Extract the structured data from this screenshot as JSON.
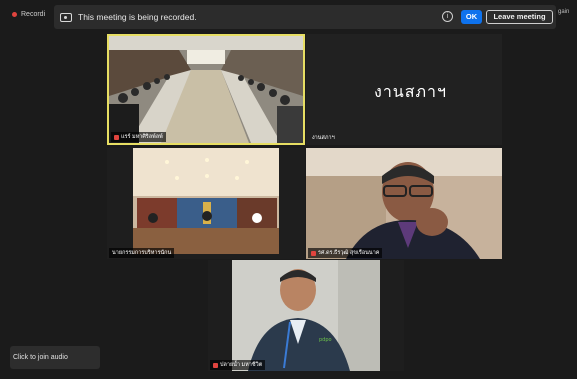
{
  "top": {
    "recording_status": "Recordi",
    "banner_message": "This meeting is being recorded.",
    "ok_label": "OK",
    "leave_label": "Leave meeting",
    "right_label": "gain"
  },
  "tiles": [
    {
      "id": "t1",
      "name": "แรร์ มหาศิริลพ์ลพ์",
      "muted": true
    },
    {
      "id": "t2",
      "display_text": "งานสภาฯ",
      "name": "งานสภาฯ",
      "muted": false
    },
    {
      "id": "t3",
      "name": "นายกรรมการบริหารนักน",
      "muted": false
    },
    {
      "id": "t4",
      "name": "รศ.ดร.ธีรวุฒิ สุขเรือนนาค",
      "muted": true
    },
    {
      "id": "t5",
      "name": "ปลายน้ำ มหาชีวิต",
      "muted": true
    }
  ],
  "audio": {
    "join_label": "Click to join audio"
  },
  "colors": {
    "active_speaker_border": "#e7de63",
    "ok_button": "#0e72ed",
    "muted_mic": "#e0443e"
  }
}
